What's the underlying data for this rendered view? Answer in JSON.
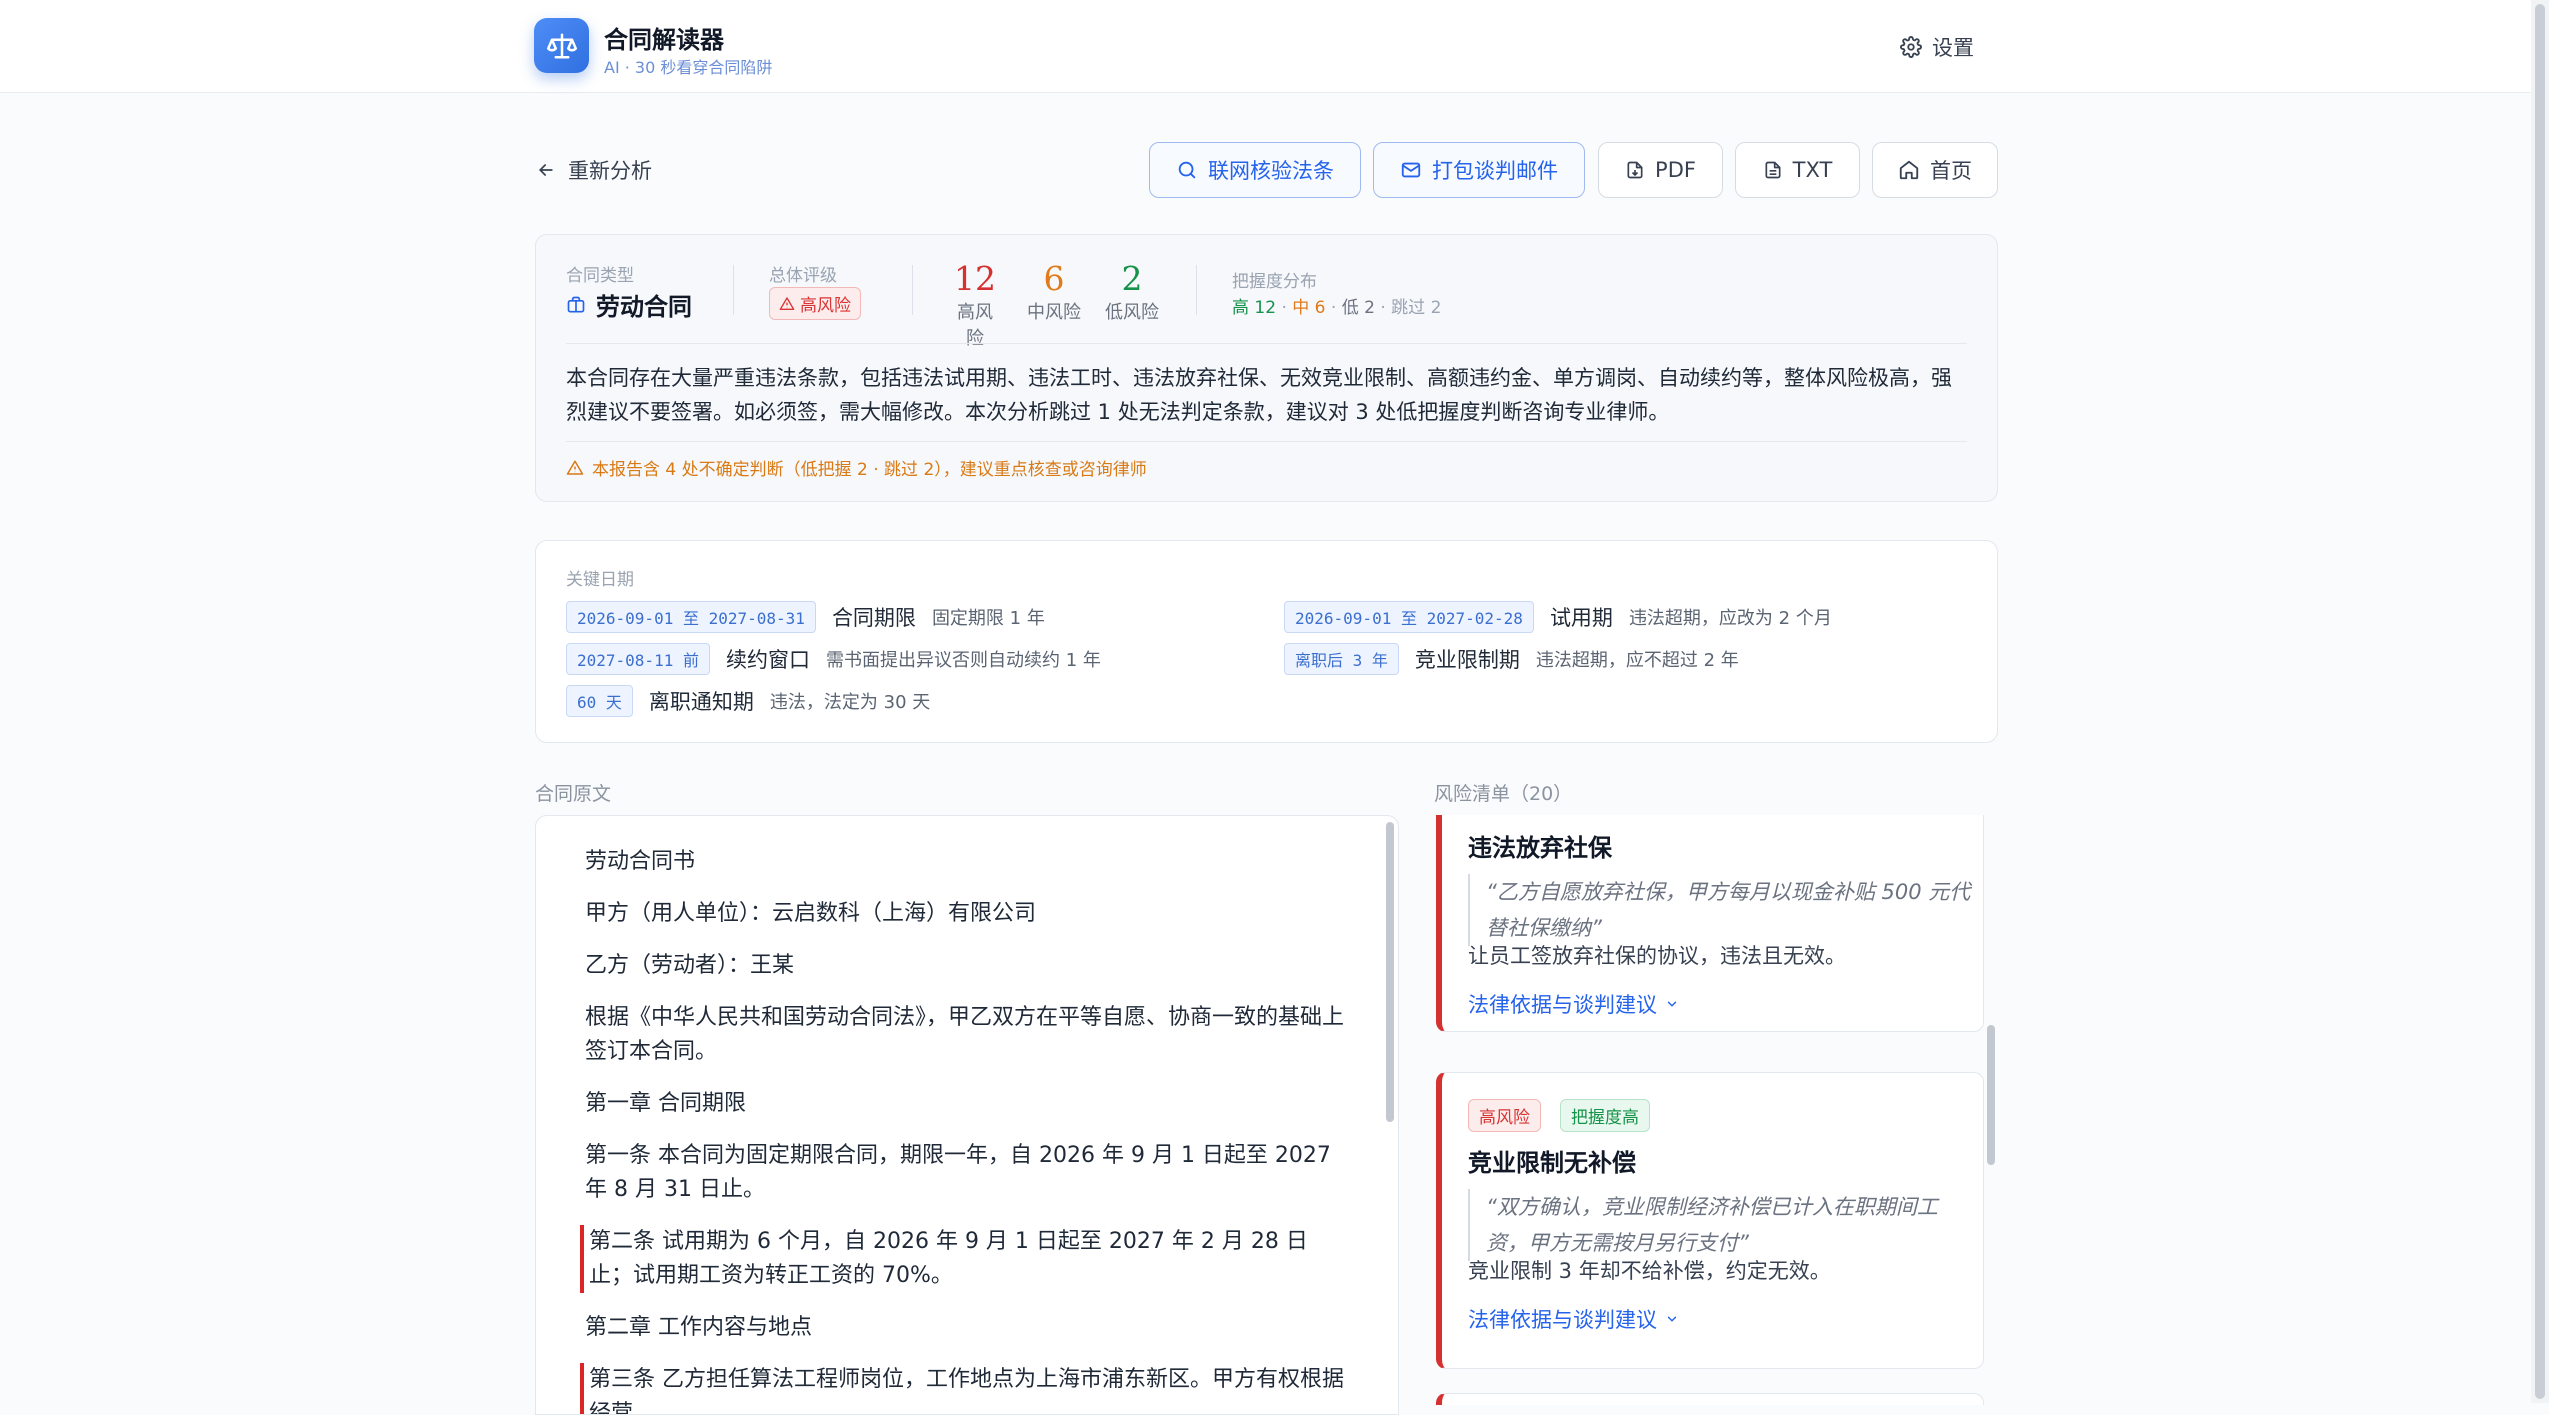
{
  "app": {
    "title": "合同解读器",
    "subtitle": "AI · 30 秒看穿合同陷阱",
    "settings_label": "设置"
  },
  "toolbar": {
    "back_label": "重新分析",
    "verify_label": "联网核验法条",
    "email_label": "打包谈判邮件",
    "pdf_label": "PDF",
    "txt_label": "TXT",
    "home_label": "首页"
  },
  "summary": {
    "type_label": "合同类型",
    "type_value": "劳动合同",
    "rating_label": "总体评级",
    "rating_value": "高风险",
    "high_count": "12",
    "high_label": "高风险",
    "mid_count": "6",
    "mid_label": "中风险",
    "low_count": "2",
    "low_label": "低风险",
    "dist_label": "把握度分布",
    "dist_high": "高 12",
    "dist_mid": "中 6",
    "dist_low": "低 2",
    "dist_skip": "跳过 2",
    "dist_sep": " · ",
    "text": "本合同存在大量严重违法条款，包括违法试用期、违法工时、违法放弃社保、无效竞业限制、高额违约金、单方调岗、自动续约等，整体风险极高，强烈建议不要签署。如必须签，需大幅修改。本次分析跳过 1 处无法判定条款，建议对 3 处低把握度判断咨询专业律师。",
    "warning": "本报告含 4 处不确定判断（低把握 2 · 跳过 2），建议重点核查或咨询律师"
  },
  "dates": {
    "label": "关键日期",
    "items": [
      {
        "chip": "2026-09-01 至 2027-08-31",
        "title": "合同期限",
        "note": "固定期限 1 年"
      },
      {
        "chip": "2026-09-01 至 2027-02-28",
        "title": "试用期",
        "note": "违法超期，应改为 2 个月"
      },
      {
        "chip": "2027-08-11 前",
        "title": "续约窗口",
        "note": "需书面提出异议否则自动续约 1 年"
      },
      {
        "chip": "离职后 3 年",
        "title": "竞业限制期",
        "note": "违法超期，应不超过 2 年"
      },
      {
        "chip": "60 天",
        "title": "离职通知期",
        "note": "违法，法定为 30 天"
      }
    ]
  },
  "contract": {
    "label": "合同原文",
    "paragraphs": [
      "劳动合同书",
      "甲方（用人单位）：云启数科（上海）有限公司",
      "乙方（劳动者）：王某",
      "根据《中华人民共和国劳动合同法》，甲乙双方在平等自愿、协商一致的基础上签订本合同。",
      "第一章 合同期限",
      "第一条 本合同为固定期限合同，期限一年，自 2026 年 9 月 1 日起至 2027 年 8 月 31 日止。",
      "第二条 试用期为 6 个月，自 2026 年 9 月 1 日起至 2027 年 2 月 28 日止；试用期工资为转正工资的 70%。",
      "第二章 工作内容与地点",
      "第三条 乙方担任算法工程师岗位，工作地点为上海市浦东新区。甲方有权根据经营"
    ]
  },
  "risks": {
    "label": "风险清单（20）",
    "items": [
      {
        "title": "违法放弃社保",
        "quote": "“乙方自愿放弃社保，甲方每月以现金补贴 500 元代替社保缴纳”",
        "desc": "让员工签放弃社保的协议，违法且无效。",
        "more": "法律依据与谈判建议"
      },
      {
        "tag_risk": "高风险",
        "tag_conf": "把握度高",
        "title": "竞业限制无补偿",
        "quote": "“双方确认，竞业限制经济补偿已计入在职期间工资，甲方无需按月另行支付”",
        "desc": "竞业限制 3 年却不给补偿，约定无效。",
        "more": "法律依据与谈判建议"
      }
    ]
  },
  "colors": {
    "accent": "#2563eb",
    "high": "#d63131",
    "mid": "#e07a1a",
    "low": "#16924a"
  }
}
